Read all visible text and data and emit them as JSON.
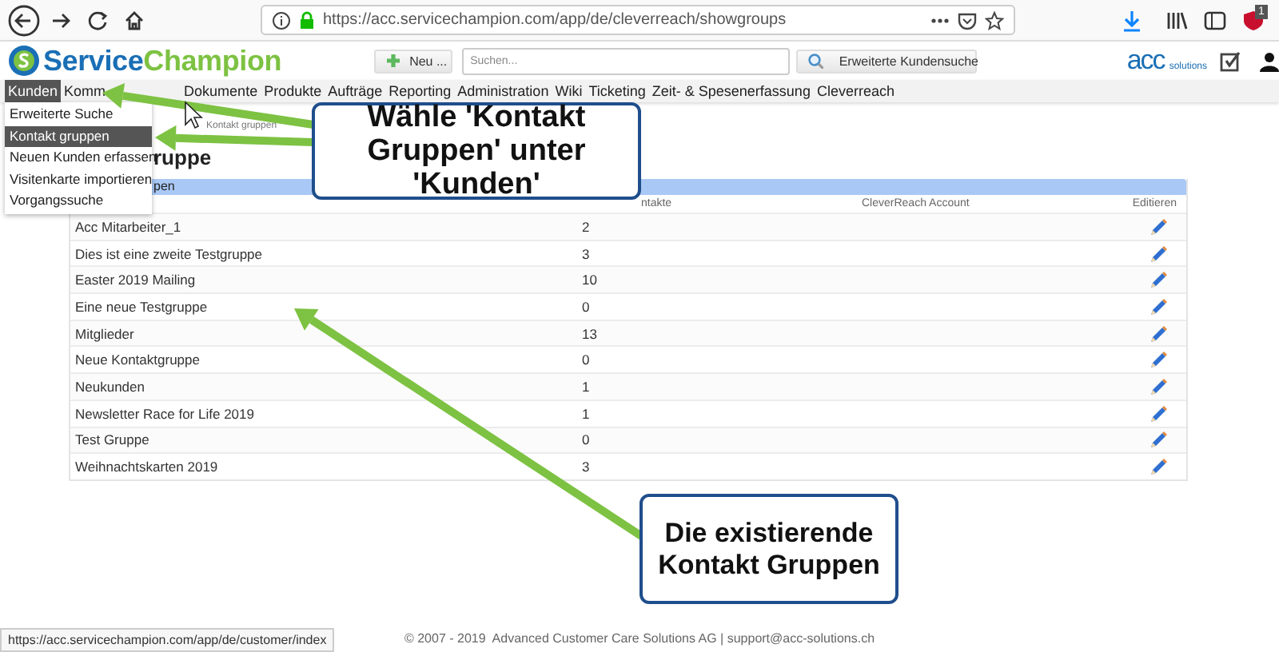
{
  "browser": {
    "url": "https://acc.servicechampion.com/app/de/cleverreach/showgroups",
    "extension_badge": "1"
  },
  "header": {
    "logo": {
      "part1": "Service",
      "part2": "Champion"
    },
    "new_button": "Neu ...",
    "search": {
      "placeholder": "Suchen..."
    },
    "advanced_search_button": "Erweiterte Kundensuche",
    "partner_logo": {
      "mark": "acc",
      "text": "solutions"
    }
  },
  "nav": [
    {
      "label": "Kunden",
      "selected": true
    },
    {
      "label": "Komm",
      "selected": false
    },
    {
      "label": "Dokumente",
      "selected": false
    },
    {
      "label": "Produkte",
      "selected": false
    },
    {
      "label": "Aufträge",
      "selected": false
    },
    {
      "label": "Reporting",
      "selected": false
    },
    {
      "label": "Administration",
      "selected": false
    },
    {
      "label": "Wiki",
      "selected": false
    },
    {
      "label": "Ticketing",
      "selected": false
    },
    {
      "label": "Zeit- & Spesenerfassung",
      "selected": false
    },
    {
      "label": "Cleverreach",
      "selected": false
    }
  ],
  "dropdown": [
    {
      "label": "Erweiterte Suche",
      "selected": false
    },
    {
      "label": "Kontakt gruppen",
      "selected": true
    },
    {
      "label": "Neuen Kunden erfassen",
      "selected": false
    },
    {
      "label": "Visitenkarte importieren",
      "selected": false
    },
    {
      "label": "Vorgangssuche",
      "selected": false
    }
  ],
  "page": {
    "breadcrumb": "Kontakt gruppen",
    "title": "ruppe",
    "caption": "pen",
    "columns": {
      "count": "ntakte",
      "account": "CleverReach Account",
      "edit": "Editieren"
    },
    "rows": [
      {
        "name": "Acc Mitarbeiter_1",
        "count": "2"
      },
      {
        "name": "Dies ist eine zweite Testgruppe",
        "count": "3"
      },
      {
        "name": "Easter 2019 Mailing",
        "count": "10"
      },
      {
        "name": "Eine neue Testgruppe",
        "count": "0"
      },
      {
        "name": "Mitglieder",
        "count": "13"
      },
      {
        "name": "Neue Kontaktgruppe",
        "count": "0"
      },
      {
        "name": "Neukunden",
        "count": "1"
      },
      {
        "name": "Newsletter Race for Life 2019",
        "count": "1"
      },
      {
        "name": "Test Gruppe",
        "count": "0"
      },
      {
        "name": "Weihnachtskarten 2019",
        "count": "3"
      }
    ]
  },
  "footer": "© 2007 - 2019  Advanced Customer Care Solutions AG | support@acc-solutions.ch",
  "status_link": "https://acc.servicechampion.com/app/de/customer/index",
  "callouts": [
    {
      "text": "Wähle 'Kontakt Gruppen' unter 'Kunden'"
    },
    {
      "text": "Die existierende Kontakt Gruppen"
    }
  ]
}
